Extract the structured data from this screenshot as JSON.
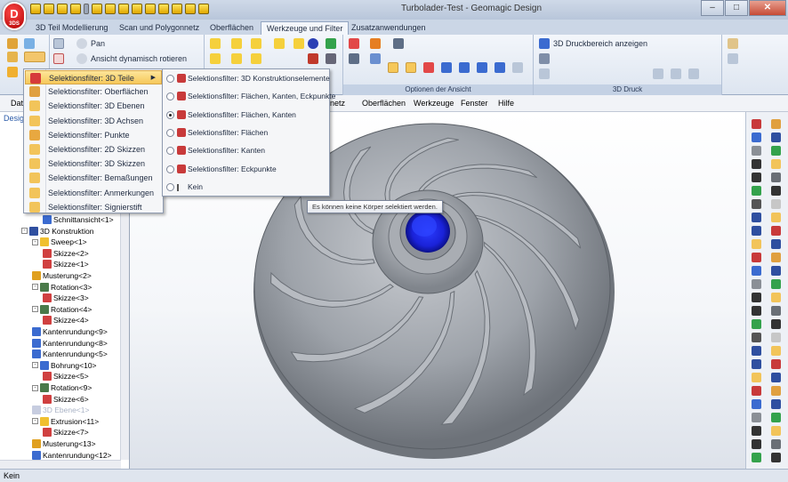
{
  "window": {
    "title": "Turbolader-Test - Geomagic Design",
    "logo_letter": "D",
    "logo_sub": "3DS"
  },
  "ribbon_tabs": [
    "3D Teil Modellierung",
    "Scan und Polygonnetz",
    "Oberflächen",
    "Werkzeuge und Filter",
    "Zusatzanwendungen"
  ],
  "ribbon": {
    "pan_label": "Pan",
    "rotate_label": "Ansicht dynamisch rotieren",
    "print_area_label": "3D Druckbereich anzeigen",
    "group_view_options": "Optionen der Ansicht",
    "group_3d_print": "3D Druck"
  },
  "menubar": {
    "items": [
      "Date",
      "nnetz",
      "Oberflächen",
      "Werkzeuge",
      "Fenster",
      "Hilfe"
    ]
  },
  "left_panel": {
    "tab_label": "Desig",
    "tree": [
      {
        "label": "Schnittansicht<1>",
        "indent": 2,
        "icon": "section-icon",
        "expander": ""
      },
      {
        "label": "3D Konstruktion",
        "indent": 0,
        "icon": "folder-icon",
        "expander": "-"
      },
      {
        "label": "Sweep<1>",
        "indent": 1,
        "icon": "sweep-icon",
        "expander": "-"
      },
      {
        "label": "Skizze<2>",
        "indent": 2,
        "icon": "sketch-icon",
        "expander": ""
      },
      {
        "label": "Skizze<1>",
        "indent": 2,
        "icon": "sketch-icon",
        "expander": ""
      },
      {
        "label": "Musterung<2>",
        "indent": 1,
        "icon": "pattern-icon",
        "expander": ""
      },
      {
        "label": "Rotation<3>",
        "indent": 1,
        "icon": "revolve-icon",
        "expander": "-"
      },
      {
        "label": "Skizze<3>",
        "indent": 2,
        "icon": "sketch-icon",
        "expander": ""
      },
      {
        "label": "Rotation<4>",
        "indent": 1,
        "icon": "revolve-icon",
        "expander": "-"
      },
      {
        "label": "Skizze<4>",
        "indent": 2,
        "icon": "sketch-icon",
        "expander": ""
      },
      {
        "label": "Kantenrundung<9>",
        "indent": 1,
        "icon": "fillet-icon",
        "expander": ""
      },
      {
        "label": "Kantenrundung<8>",
        "indent": 1,
        "icon": "fillet-icon",
        "expander": ""
      },
      {
        "label": "Kantenrundung<5>",
        "indent": 1,
        "icon": "fillet-icon",
        "expander": ""
      },
      {
        "label": "Bohrung<10>",
        "indent": 1,
        "icon": "hole-icon",
        "expander": "-"
      },
      {
        "label": "Skizze<5>",
        "indent": 2,
        "icon": "sketch-icon",
        "expander": ""
      },
      {
        "label": "Rotation<9>",
        "indent": 1,
        "icon": "revolve-icon",
        "expander": "-"
      },
      {
        "label": "Skizze<6>",
        "indent": 2,
        "icon": "sketch-icon",
        "expander": ""
      },
      {
        "label": "3D Ebene<1>",
        "indent": 1,
        "icon": "plane-icon",
        "expander": "",
        "dim": true
      },
      {
        "label": "Extrusion<11>",
        "indent": 1,
        "icon": "extrude-icon",
        "expander": "-"
      },
      {
        "label": "Skizze<7>",
        "indent": 2,
        "icon": "sketch-icon",
        "expander": ""
      },
      {
        "label": "Musterung<13>",
        "indent": 1,
        "icon": "pattern-icon",
        "expander": ""
      },
      {
        "label": "Kantenrundung<12>",
        "indent": 1,
        "icon": "fillet-icon",
        "expander": ""
      }
    ]
  },
  "selection_menu": {
    "items": [
      "Selektionsfilter: 3D Teile",
      "Selektionsfilter: Oberflächen",
      "Selektionsfilter: 3D Ebenen",
      "Selektionsfilter: 3D Achsen",
      "Selektionsfilter: Punkte",
      "Selektionsfilter: 2D Skizzen",
      "Selektionsfilter: 3D Skizzen",
      "Selektionsfilter: Bemaßungen",
      "Selektionsfilter: Anmerkungen",
      "Selektionsfilter: Signierstift"
    ],
    "highlighted_index": 0,
    "submenu_arrow": "▶"
  },
  "submenu": {
    "items": [
      "Selektionsfilter: 3D Konstruktionselemente",
      "Selektionsfilter: Flächen, Kanten, Eckpunkte",
      "Selektionsfilter: Flächen, Kanten",
      "Selektionsfilter: Flächen",
      "Selektionsfilter: Kanten",
      "Selektionsfilter: Eckpunkte",
      "Kein"
    ],
    "selected_index": 2
  },
  "tooltip": {
    "text": "Es können keine Körper selektiert werden."
  },
  "status": {
    "text": "Kein"
  },
  "colors": {
    "accent": "#f6c85a",
    "hub": "#1a2cff",
    "part": "#8a8f96"
  }
}
